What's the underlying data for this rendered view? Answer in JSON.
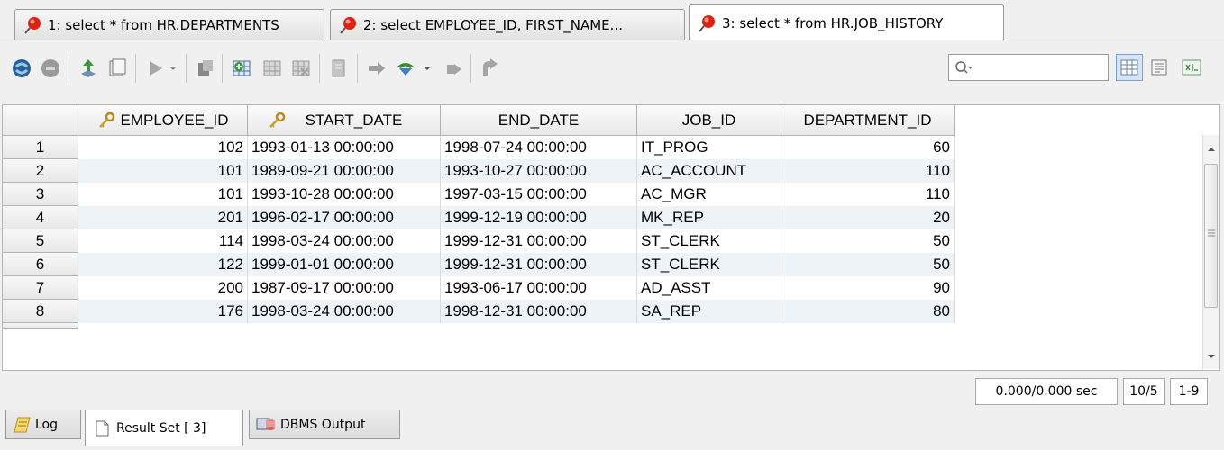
{
  "tabs": [
    {
      "label": "1: select * from HR.DEPARTMENTS"
    },
    {
      "label": "2: select EMPLOYEE_ID, FIRST_NAME..."
    },
    {
      "label": "3: select * from HR.JOB_HISTORY"
    }
  ],
  "toolbar": {
    "icons": [
      "database-icon",
      "stop-icon",
      "export-icon",
      "script-icon",
      "commit-icon",
      "dropdown-icon",
      "copy-icon",
      "add-row-icon",
      "table-icon",
      "delete-row-icon",
      "edit-icon",
      "navigate-icon",
      "refresh-icon",
      "dropdown-icon",
      "undo-icon",
      "redo-icon"
    ]
  },
  "search": {
    "placeholder": ""
  },
  "grid": {
    "columns": [
      "EMPLOYEE_ID",
      "START_DATE",
      "END_DATE",
      "JOB_ID",
      "DEPARTMENT_ID"
    ],
    "rows": [
      {
        "num": "1",
        "cells": [
          "102",
          "1993-01-13 00:00:00",
          "1998-07-24 00:00:00",
          "IT_PROG",
          "60"
        ]
      },
      {
        "num": "2",
        "cells": [
          "101",
          "1989-09-21 00:00:00",
          "1993-10-27 00:00:00",
          "AC_ACCOUNT",
          "110"
        ]
      },
      {
        "num": "3",
        "cells": [
          "101",
          "1993-10-28 00:00:00",
          "1997-03-15 00:00:00",
          "AC_MGR",
          "110"
        ]
      },
      {
        "num": "4",
        "cells": [
          "201",
          "1996-02-17 00:00:00",
          "1999-12-19 00:00:00",
          "MK_REP",
          "20"
        ]
      },
      {
        "num": "5",
        "cells": [
          "114",
          "1998-03-24 00:00:00",
          "1999-12-31 00:00:00",
          "ST_CLERK",
          "50"
        ]
      },
      {
        "num": "6",
        "cells": [
          "122",
          "1999-01-01 00:00:00",
          "1999-12-31 00:00:00",
          "ST_CLERK",
          "50"
        ]
      },
      {
        "num": "7",
        "cells": [
          "200",
          "1987-09-17 00:00:00",
          "1993-06-17 00:00:00",
          "AD_ASST",
          "90"
        ]
      },
      {
        "num": "8",
        "cells": [
          "176",
          "1998-03-24 00:00:00",
          "1998-12-31 00:00:00",
          "SA_REP",
          "80"
        ]
      }
    ]
  },
  "status": {
    "time": "0.000/0.000 sec",
    "count": "10/5",
    "range": "1-9"
  },
  "bottom_tabs": [
    {
      "label": "Log"
    },
    {
      "label": "Result Set [ 3]"
    },
    {
      "label": "DBMS Output"
    }
  ],
  "colors": {
    "alt_row": "#eef3f8",
    "header_bg": "#f0f0f0"
  }
}
